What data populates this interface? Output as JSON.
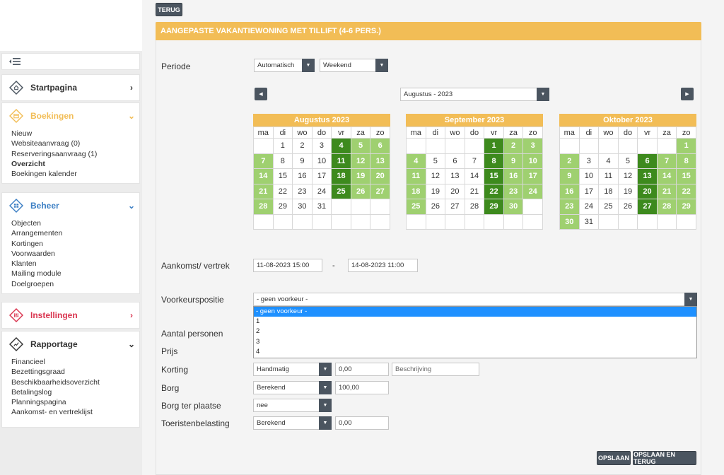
{
  "back_button": "TERUG",
  "page_title": "AANGEPASTE VAKANTIEWONING MET TILLIFT (4-6 PERS.)",
  "sidebar": {
    "startpagina": "Startpagina",
    "boekingen": {
      "label": "Boekingen",
      "items": [
        "Nieuw",
        "Websiteaanvraag (0)",
        "Reserveringsaanvraag (1)",
        "Overzicht",
        "Boekingen kalender"
      ]
    },
    "beheer": {
      "label": "Beheer",
      "items": [
        "Objecten",
        "Arrangementen",
        "Kortingen",
        "Voorwaarden",
        "Klanten",
        "Mailing module",
        "Doelgroepen"
      ]
    },
    "instellingen": "Instellingen",
    "rapportage": {
      "label": "Rapportage",
      "items": [
        "Financieel",
        "Bezettingsgraad",
        "Beschikbaarheidsoverzicht",
        "Betalingslog",
        "Planningspagina",
        "Aankomst- en vertreklijst"
      ]
    }
  },
  "form": {
    "periode_label": "Periode",
    "periode_mode": "Automatisch",
    "periode_type": "Weekend",
    "month_select": "Augustus - 2023",
    "aankomst_label": "Aankomst/ vertrek",
    "aankomst": "11-08-2023 15:00",
    "dash": "-",
    "vertrek": "14-08-2023 11:00",
    "voorkeur_label": "Voorkeurspositie",
    "voorkeur_value": "- geen voorkeur -",
    "voorkeur_options": [
      "- geen voorkeur -",
      "1",
      "2",
      "3",
      "4"
    ],
    "aantal_label": "Aantal personen",
    "prijs_label": "Prijs",
    "korting_label": "Korting",
    "korting_mode": "Handmatig",
    "korting_value": "0,00",
    "korting_desc_placeholder": "Beschrijving",
    "borg_label": "Borg",
    "borg_mode": "Berekend",
    "borg_value": "100,00",
    "borg_plaatse_label": "Borg ter plaatse",
    "borg_plaatse_value": "nee",
    "toeristen_label": "Toeristenbelasting",
    "toeristen_mode": "Berekend",
    "toeristen_value": "0,00"
  },
  "calendar": {
    "weekdays": [
      "ma",
      "di",
      "wo",
      "do",
      "vr",
      "za",
      "zo"
    ],
    "months": [
      {
        "title": "Augustus 2023",
        "offset": 1,
        "days": 31,
        "light": [
          5,
          6,
          7,
          12,
          13,
          14,
          19,
          20,
          21,
          26,
          27,
          28
        ],
        "dark": [
          4,
          11,
          18,
          25
        ]
      },
      {
        "title": "September 2023",
        "offset": 4,
        "days": 30,
        "light": [
          2,
          3,
          4,
          9,
          10,
          11,
          16,
          17,
          18,
          23,
          24,
          25,
          30
        ],
        "dark": [
          1,
          8,
          15,
          22,
          29
        ]
      },
      {
        "title": "Oktober 2023",
        "offset": 6,
        "days": 31,
        "light": [
          1,
          2,
          7,
          8,
          9,
          14,
          15,
          16,
          21,
          22,
          23,
          28,
          29,
          30
        ],
        "dark": [
          6,
          13,
          20,
          27
        ]
      }
    ]
  },
  "buttons": {
    "save": "OPSLAAN",
    "save_back": "OPSLAAN EN TERUG"
  },
  "colors": {
    "accent": "#f2bd56",
    "dark": "#4b5560",
    "light_green": "#9fd070",
    "dark_green": "#3d8a1d"
  }
}
